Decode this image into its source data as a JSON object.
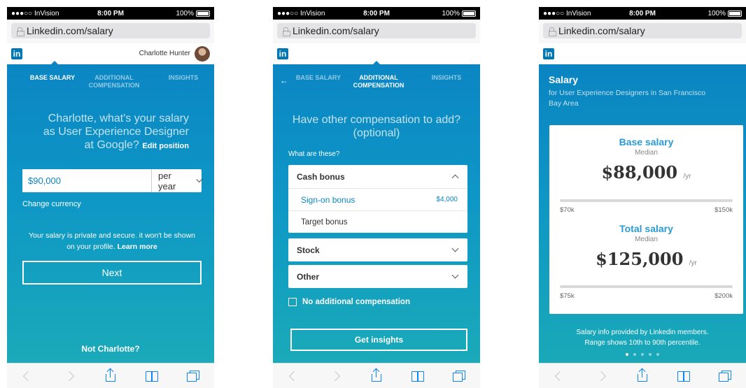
{
  "status": {
    "carrier": "●●●○○ InVision",
    "time": "8:00 PM",
    "battery": "100%"
  },
  "browser": {
    "url": "Linkedin.com/salary"
  },
  "header": {
    "logo": "in",
    "user_name": "Charlotte Hunter"
  },
  "tabs": {
    "base_salary": "BASE SALARY",
    "additional_line1": "ADDITIONAL",
    "additional_line2": "COMPENSATION",
    "insights": "INSIGHTS"
  },
  "screen1": {
    "question_line1": "Charlotte, what's your salary",
    "question_line2": "as User Experience Designer",
    "question_line3": "at Google?",
    "edit_position": "Edit position",
    "salary_value": "$90,000",
    "period": "per year",
    "change_currency": "Change currency",
    "privacy_text": "Your salary is private and secure. it won't be shown on your profile.",
    "learn_more": "Learn more",
    "next_label": "Next",
    "not_user": "Not Charlotte?"
  },
  "screen2": {
    "back": "←",
    "question_line1": "Have other compensation to add?",
    "question_line2": "(optional)",
    "what_are_these": "What are these?",
    "cash_bonus": "Cash bonus",
    "sign_on_bonus": "Sign-on bonus",
    "sign_on_amount": "$4,000",
    "target_bonus": "Target bonus",
    "stock": "Stock",
    "other": "Other",
    "no_additional": "No additional compensation",
    "get_insights": "Get insights"
  },
  "screen3": {
    "title": "Salary",
    "subtitle": "for User Experience Designers in San Francisco Bay Area",
    "base_title": "Base salary",
    "base_median": "Median",
    "base_value": "$88,000",
    "base_unit": "/yr",
    "base_min": "$70k",
    "base_max": "$150k",
    "total_title": "Total salary",
    "total_median": "Median",
    "total_value": "$125,000",
    "total_unit": "/yr",
    "total_min": "$75k",
    "total_max": "$200k",
    "info_line1": "Salary info provided by Linkedin members.",
    "info_line2": "Range shows 10th to 90th percentile.",
    "page_count": 5,
    "active_page": 1
  },
  "colors": {
    "brand": "#0077b5",
    "accent": "#0b86c3",
    "link_blue": "#2a9bd2"
  },
  "icons": [
    "back-chevron-icon",
    "forward-chevron-icon",
    "share-icon",
    "bookmarks-icon",
    "tabs-icon",
    "lock-icon"
  ]
}
